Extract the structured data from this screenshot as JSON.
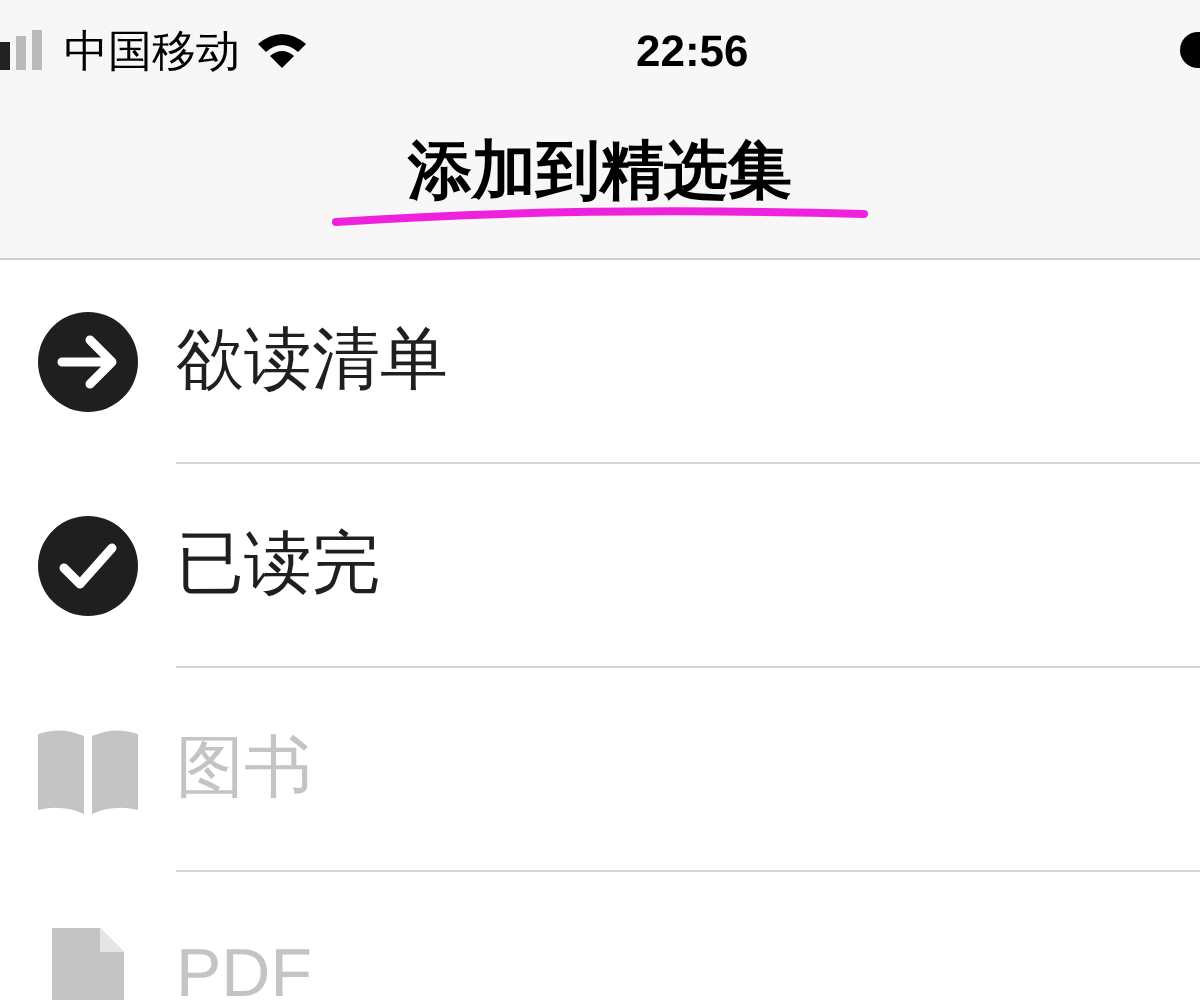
{
  "status_bar": {
    "carrier": "中国移动",
    "time": "22:56"
  },
  "title": "添加到精选集",
  "collections": [
    {
      "kind": "arrow",
      "label": "欲读清单",
      "disabled": false
    },
    {
      "kind": "check",
      "label": "已读完",
      "disabled": false
    },
    {
      "kind": "book",
      "label": "图书",
      "disabled": true
    },
    {
      "kind": "document",
      "label": "PDF",
      "disabled": true
    }
  ]
}
